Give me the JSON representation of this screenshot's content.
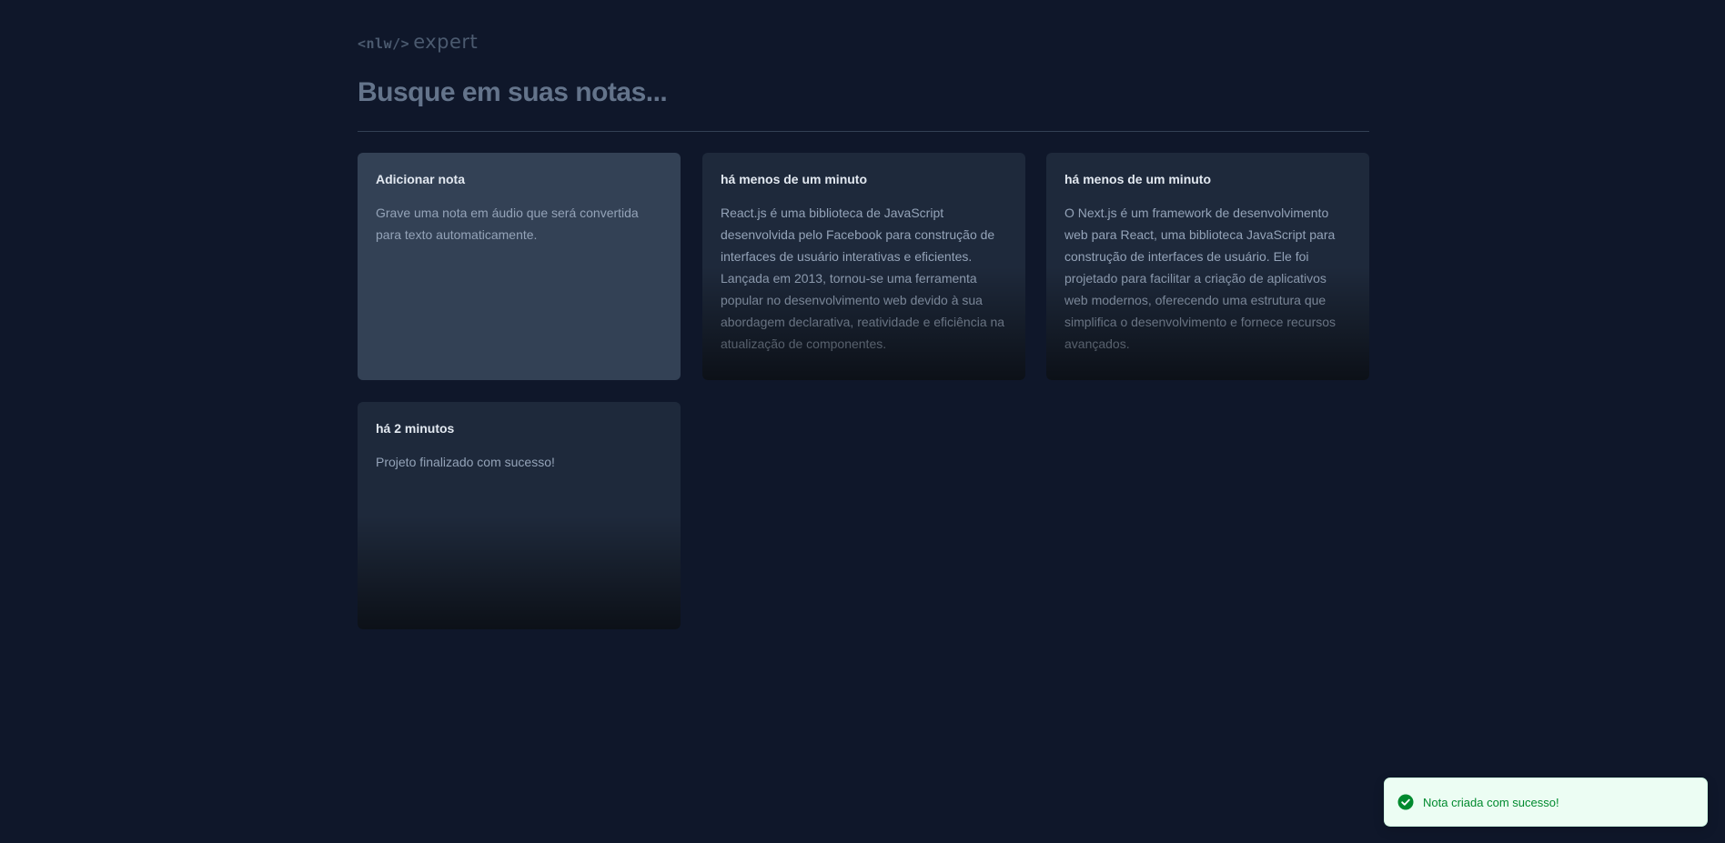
{
  "logo": {
    "code": "<nlw/>",
    "word": "expert"
  },
  "search": {
    "placeholder": "Busque em suas notas...",
    "value": ""
  },
  "add_card": {
    "title": "Adicionar nota",
    "description": "Grave uma nota em áudio que será convertida para texto automaticamente."
  },
  "notes": [
    {
      "date": "há menos de um minuto",
      "content": "React.js é uma biblioteca de JavaScript desenvolvida pelo Facebook para construção de interfaces de usuário interativas e eficientes. Lançada em 2013, tornou-se uma ferramenta popular no desenvolvimento web devido à sua abordagem declarativa, reatividade e eficiência na atualização de componentes."
    },
    {
      "date": "há menos de um minuto",
      "content": "O Next.js é um framework de desenvolvimento web para React, uma biblioteca JavaScript para construção de interfaces de usuário. Ele foi projetado para facilitar a criação de aplicativos web modernos, oferecendo uma estrutura que simplifica o desenvolvimento e fornece recursos avançados."
    },
    {
      "date": "há 2 minutos",
      "content": "Projeto finalizado com sucesso!"
    }
  ],
  "toast": {
    "message": "Nota criada com sucesso!",
    "icon": "check-circle-icon",
    "color": "#008a2e"
  },
  "colors": {
    "background": "#0f172a",
    "card_add": "#334155",
    "card_note": "#1e293b"
  }
}
